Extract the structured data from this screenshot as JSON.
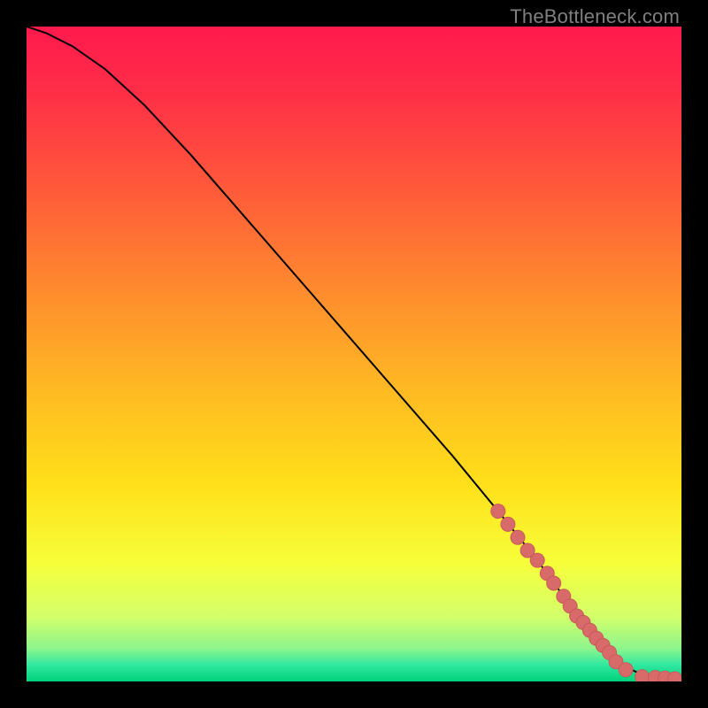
{
  "watermark": "TheBottleneck.com",
  "colors": {
    "gradient_stops": [
      {
        "offset": 0.0,
        "color": "#ff1a4d"
      },
      {
        "offset": 0.1,
        "color": "#ff2e47"
      },
      {
        "offset": 0.25,
        "color": "#ff5a3a"
      },
      {
        "offset": 0.4,
        "color": "#ff8a2e"
      },
      {
        "offset": 0.55,
        "color": "#ffb823"
      },
      {
        "offset": 0.7,
        "color": "#ffe01a"
      },
      {
        "offset": 0.82,
        "color": "#f6ff3a"
      },
      {
        "offset": 0.9,
        "color": "#d4ff6a"
      },
      {
        "offset": 0.95,
        "color": "#8cf58c"
      },
      {
        "offset": 0.975,
        "color": "#30e8a0"
      },
      {
        "offset": 1.0,
        "color": "#00d27a"
      }
    ],
    "curve": "#000000",
    "dot_fill": "#d86a6a",
    "dot_stroke": "#c85a5a"
  },
  "chart_data": {
    "type": "line",
    "title": "",
    "xlabel": "",
    "ylabel": "",
    "xlim": [
      0,
      100
    ],
    "ylim": [
      0,
      100
    ],
    "series": [
      {
        "name": "bottleneck-curve",
        "x": [
          0,
          3,
          7,
          12,
          18,
          25,
          35,
          45,
          55,
          65,
          72,
          78,
          82,
          85,
          88,
          90,
          93,
          96,
          100
        ],
        "y": [
          100,
          99,
          97,
          93.5,
          88,
          80.5,
          69,
          57.5,
          46,
          34.5,
          26,
          18.5,
          13,
          9,
          5.5,
          3,
          1.5,
          0.6,
          0.4
        ]
      }
    ],
    "markers": {
      "name": "highlighted-points",
      "x": [
        72,
        73.5,
        75,
        76.5,
        78,
        79.5,
        80.5,
        82,
        83,
        84,
        85,
        86,
        87,
        88,
        89,
        90,
        91.5,
        94,
        96,
        97.5,
        99
      ],
      "y": [
        26,
        24,
        22,
        20,
        18.5,
        16.5,
        15,
        13,
        11.5,
        10,
        9,
        7.8,
        6.6,
        5.5,
        4.4,
        3,
        1.8,
        0.7,
        0.6,
        0.5,
        0.4
      ]
    }
  }
}
